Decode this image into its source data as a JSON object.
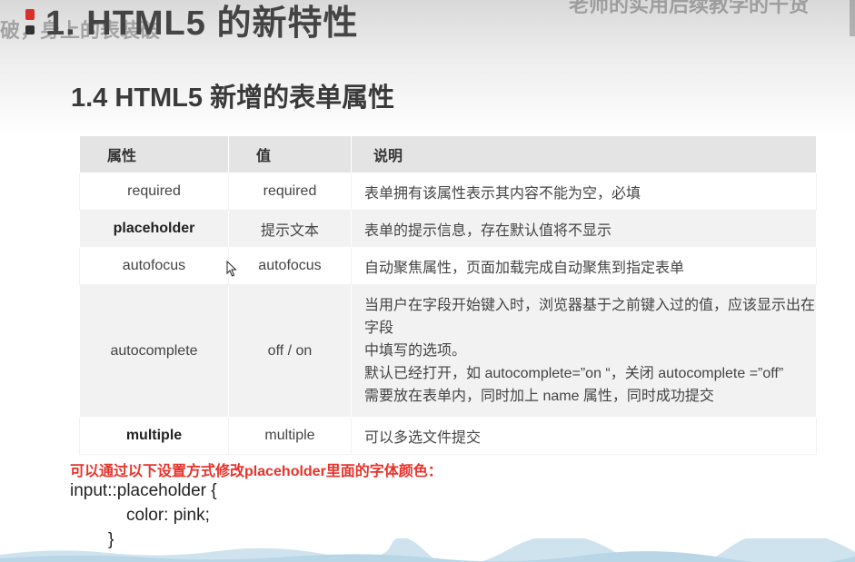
{
  "slide": {
    "title": "1. HTML5 的新特性",
    "overlay_left": "破，身上的表装破",
    "overlay_right": "老师的实用后续教学的干货"
  },
  "section_title": "1.4 HTML5 新增的表单属性",
  "table": {
    "headers": [
      "属性",
      "值",
      "说明"
    ],
    "rows": [
      {
        "attr": "required",
        "value": "required",
        "desc": [
          "表单拥有该属性表示其内容不能为空，必填"
        ],
        "bold": false
      },
      {
        "attr": "placeholder",
        "value": "提示文本",
        "desc": [
          "表单的提示信息，存在默认值将不显示"
        ],
        "bold": true
      },
      {
        "attr": "autofocus",
        "value": "autofocus",
        "desc": [
          "自动聚焦属性，页面加载完成自动聚焦到指定表单"
        ],
        "bold": false
      },
      {
        "attr": "autocomplete",
        "value": "off / on",
        "desc": [
          "当用户在字段开始键入时，浏览器基于之前键入过的值，应该显示出在字段",
          "中填写的选项。",
          "默认已经打开，如 autocomplete=”on “，关闭 autocomplete =”off”",
          "需要放在表单内，同时加上 name 属性，同时成功提交"
        ],
        "bold": false
      },
      {
        "attr": "multiple",
        "value": "multiple",
        "desc": [
          "可以多选文件提交"
        ],
        "bold": true
      }
    ]
  },
  "note": "可以通过以下设置方式修改placeholder里面的字体颜色：",
  "code": {
    "line1": "input::placeholder {",
    "line2": "color: pink;",
    "line3": "}"
  },
  "colors": {
    "note_red": "#e8322b",
    "header_bg": "#e4e4e4",
    "row_alt_bg": "#f2f2f2"
  }
}
